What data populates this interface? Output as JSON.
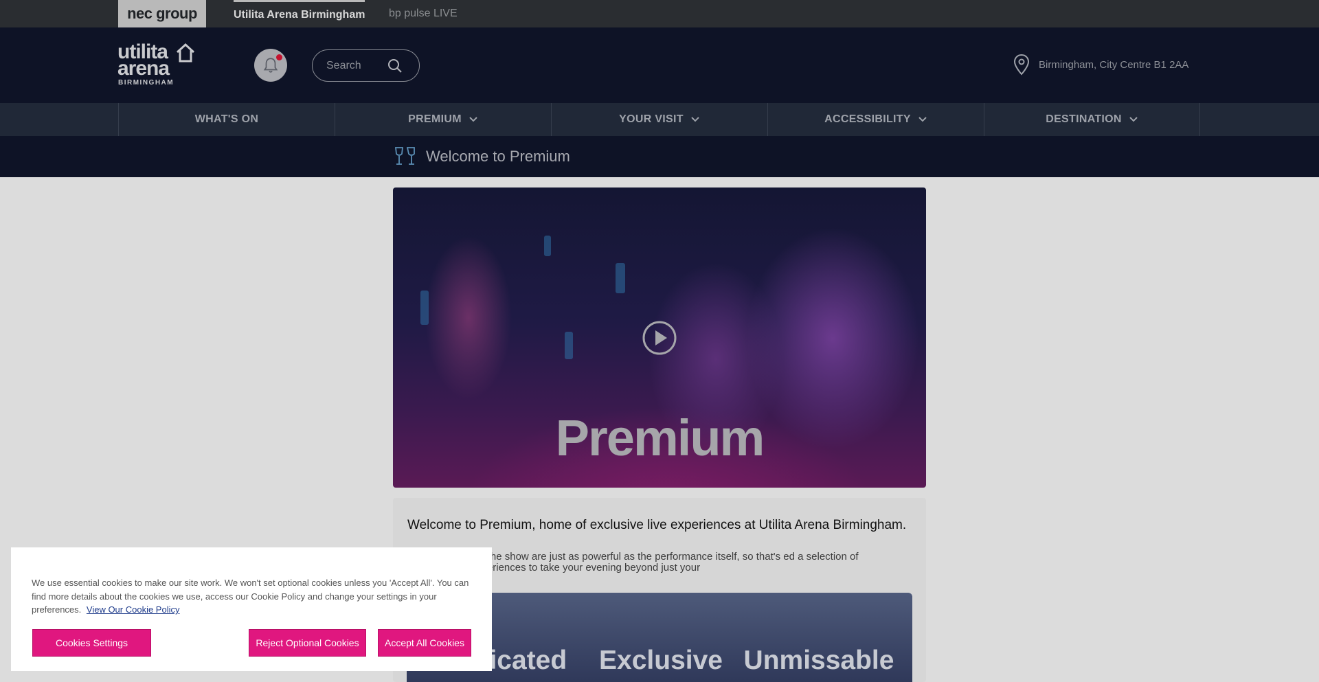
{
  "util_bar": {
    "group_logo": "nec group",
    "tabs": [
      {
        "label": "Utilita Arena Birmingham",
        "active": true
      },
      {
        "label": "bp pulse LIVE",
        "active": false
      }
    ]
  },
  "header": {
    "logo": {
      "line1": "utilita",
      "line2": "arena",
      "line3": "BIRMINGHAM"
    },
    "search": {
      "placeholder": "Search"
    },
    "location": "Birmingham, City Centre B1 2AA",
    "notification_dot_color": "#c4122f"
  },
  "nav": {
    "items": [
      {
        "label": "WHAT'S ON",
        "dropdown": false
      },
      {
        "label": "PREMIUM",
        "dropdown": true
      },
      {
        "label": "YOUR VISIT",
        "dropdown": true
      },
      {
        "label": "ACCESSIBILITY",
        "dropdown": true
      },
      {
        "label": "DESTINATION",
        "dropdown": true
      }
    ]
  },
  "subheader": {
    "title": "Welcome to Premium"
  },
  "hero": {
    "title": "Premium"
  },
  "content": {
    "intro": "Welcome to Premium, home of exclusive live experiences at Utilita Arena Birmingham.",
    "body": "moments around the show are just as powerful as the performance itself, so that's ed a selection of unforgettable experiences to take your evening beyond just your",
    "banner_words": [
      "Dedicated",
      "Exclusive",
      "Unmissable"
    ]
  },
  "cookie": {
    "text": "We use essential cookies to make our site work. We won't set optional cookies unless you 'Accept All'. You can find more details about the cookies we use, access our Cookie Policy and change your settings in your preferences.",
    "link": "View Our Cookie Policy",
    "buttons": {
      "settings": "Cookies Settings",
      "reject": "Reject Optional Cookies",
      "accept": "Accept All Cookies"
    }
  },
  "colors": {
    "accent": "#e0177f",
    "header_bg": "#0e1326",
    "nav_bg": "#202837"
  }
}
